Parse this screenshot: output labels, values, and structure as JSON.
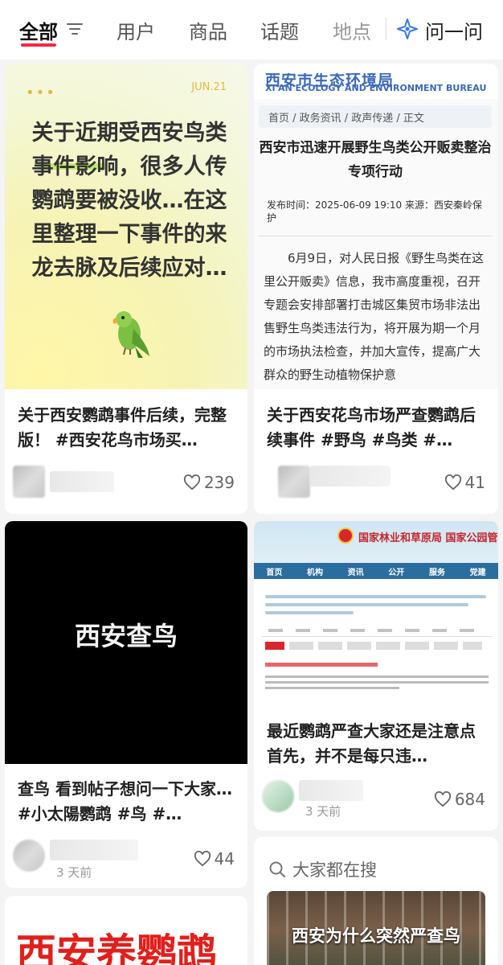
{
  "tabs": {
    "all": "全部",
    "users": "用户",
    "goods": "商品",
    "topics": "话题",
    "places": "地点",
    "ask": "问一问"
  },
  "colors": {
    "accent": "#ff2442",
    "text": "#222222",
    "muted": "#999999"
  },
  "icons": {
    "filter": "filter-icon",
    "ask": "sparkle-icon",
    "like": "heart-icon",
    "search": "search-icon"
  },
  "cards": [
    {
      "image": {
        "dots": "•••",
        "date": "JUN.21",
        "text": "关于近期受西安鸟类事件影响，很多人传鹦鹉要被没收…在这里整理一下事件的来龙去脉及后续应对…"
      },
      "title": "关于西安鹦鹉事件后续，完整版！ #西安花鸟市场买…",
      "likes": "239"
    },
    {
      "image": {
        "bureau": "西安市生态环境局",
        "bureau_en": "XI'AN ECOLOGY AND ENVIRONMENT BUREAU",
        "breadcrumb": "首页 / 政务资讯 / 政声传递 / 正文",
        "article_title": "西安市迅速开展野生鸟类公开贩卖整治专项行动",
        "meta": "发布时间：2025-06-09 19:10 来源：西安秦岭保护",
        "body": "6月9日，对人民日报《野生鸟类在这里公开贩卖》信息，我市高度重视，召开专题会安排部署打击城区集贸市场非法出售野生鸟类违法行为，将开展为期一个月的市场执法检查，并加大宣传，提高广大群众的野生动植物保护意"
      },
      "title": "关于西安花鸟市场严查鹦鹉后续事件 #野鸟 #鸟类 #…",
      "likes": "41"
    },
    {
      "image": {
        "text": "西安查鸟"
      },
      "title": "查鸟 看到帖子想问一下大家…#小太陽鹦鹉 #鸟 #…",
      "time": "3 天前",
      "likes": "44"
    },
    {
      "image": {
        "org": "国家林业和草原局 国家公园管理局",
        "nav": [
          "首页",
          "机构",
          "资讯",
          "公开",
          "服务",
          "党建"
        ]
      },
      "title": "最近鹦鹉严查大家还是注意点 首先，并不是每只违…",
      "time": "3 天前",
      "likes": "684"
    },
    {
      "image": {
        "text": "西安养鹦鹉"
      }
    }
  ],
  "search": {
    "heading": "大家都在搜",
    "query": "西安为什么突然严查鸟"
  }
}
